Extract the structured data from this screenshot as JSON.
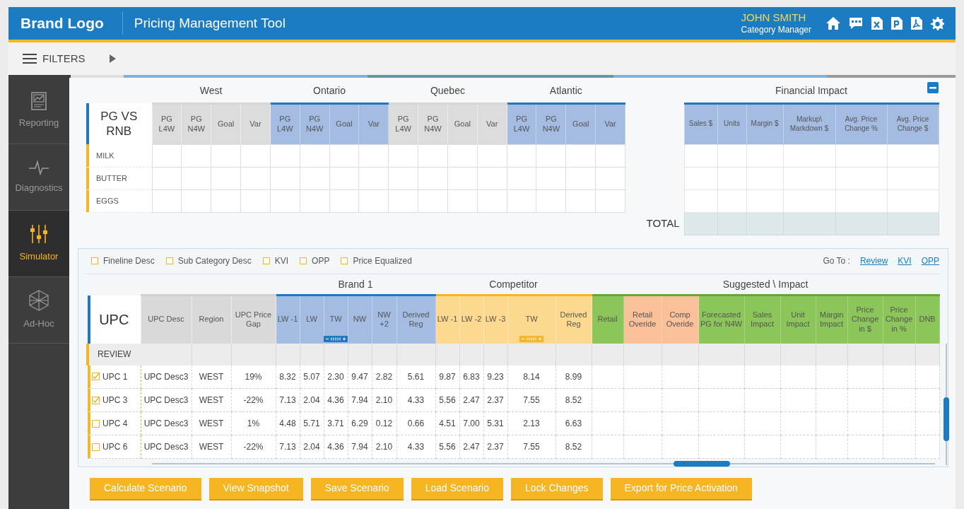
{
  "header": {
    "logo": "Brand Logo",
    "title": "Pricing Management Tool",
    "user_name": "JOHN SMITH",
    "user_role": "Category Manager"
  },
  "filter_bar": {
    "label": "FILTERS"
  },
  "sidebar": {
    "items": [
      {
        "label": "Reporting",
        "kind": "report",
        "selected": false
      },
      {
        "label": "Diagnostics",
        "kind": "pulse",
        "selected": false
      },
      {
        "label": "Simulator",
        "kind": "sliders",
        "selected": true
      },
      {
        "label": "Ad-Hoc",
        "kind": "cube",
        "selected": false
      }
    ]
  },
  "region_table": {
    "corner": "PG VS RNB",
    "groups": [
      {
        "label": "West",
        "highlighted": false,
        "columns": [
          "PG L4W",
          "PG N4W",
          "Goal",
          "Var"
        ]
      },
      {
        "label": "Ontario",
        "highlighted": true,
        "columns": [
          "PG L4W",
          "PG N4W",
          "Goal",
          "Var"
        ]
      },
      {
        "label": "Quebec",
        "highlighted": false,
        "columns": [
          "PG L4W",
          "PG N4W",
          "Goal",
          "Var"
        ]
      },
      {
        "label": "Atlantic",
        "highlighted": true,
        "columns": [
          "PG L4W",
          "PG N4W",
          "Goal",
          "Var"
        ]
      }
    ],
    "rows": [
      "MILK",
      "BUTTER",
      "EGGS"
    ]
  },
  "financial_impact": {
    "title": "Financial Impact",
    "columns": [
      "Sales $",
      "Units",
      "Margin $",
      "Markup\\ Markdown $",
      "Avg. Price Change %",
      "Avg. Price Change $"
    ],
    "total_label": "TOTAL"
  },
  "legend": [
    {
      "label": "Fineline Desc",
      "checked": false
    },
    {
      "label": "Sub Category Desc",
      "checked": false
    },
    {
      "label": "KVI",
      "checked": false
    },
    {
      "label": "OPP",
      "checked": false
    },
    {
      "label": "Price Equalized",
      "checked": false
    }
  ],
  "goto": {
    "label": "Go To :",
    "links": [
      "Review",
      "KVI",
      "OPP"
    ]
  },
  "upc_table": {
    "key_column": "UPC",
    "groups": [
      {
        "kind": "plain",
        "columns": [
          {
            "label": "UPC Desc",
            "kind": "plain",
            "stepper": false
          },
          {
            "label": "Region",
            "kind": "plain",
            "stepper": false
          },
          {
            "label": "UPC Price Gap",
            "kind": "plain",
            "stepper": false
          }
        ]
      },
      {
        "label": "Brand 1",
        "kind": "brand",
        "columns": [
          {
            "label": "LW -1",
            "kind": "brand",
            "stepper": false
          },
          {
            "label": "LW",
            "kind": "brand",
            "stepper": false
          },
          {
            "label": "TW",
            "kind": "brand",
            "stepper": true
          },
          {
            "label": "NW",
            "kind": "brand",
            "stepper": false
          },
          {
            "label": "NW +2",
            "kind": "brand",
            "stepper": false
          },
          {
            "label": "Derived Reg",
            "kind": "brand",
            "stepper": false
          }
        ]
      },
      {
        "label": "Competitor",
        "kind": "competitor",
        "columns": [
          {
            "label": "LW -1",
            "kind": "competitor",
            "stepper": false
          },
          {
            "label": "LW -2",
            "kind": "competitor",
            "stepper": false
          },
          {
            "label": "LW -3",
            "kind": "competitor",
            "stepper": false
          },
          {
            "label": "TW",
            "kind": "competitor",
            "stepper": true
          },
          {
            "label": "Derived Reg",
            "kind": "competitor",
            "stepper": false
          }
        ]
      },
      {
        "label": "Suggested \\ Impact",
        "kind": "suggested",
        "columns": [
          {
            "label": "Retail",
            "kind": "suggested",
            "stepper": false
          },
          {
            "label": "Retail Overide",
            "kind": "override",
            "stepper": false
          },
          {
            "label": "Comp Overide",
            "kind": "override",
            "stepper": false
          },
          {
            "label": "Forecasted PG for N4W",
            "kind": "suggested",
            "stepper": false
          },
          {
            "label": "Sales Impact",
            "kind": "suggested",
            "stepper": false
          },
          {
            "label": "Unit Impact",
            "kind": "suggested",
            "stepper": false
          },
          {
            "label": "Margin Impact",
            "kind": "suggested",
            "stepper": false
          },
          {
            "label": "Price Change in $",
            "kind": "suggested",
            "stepper": false
          },
          {
            "label": "Price Change in %",
            "kind": "suggested",
            "stepper": false
          },
          {
            "label": "DNB",
            "kind": "suggested",
            "stepper": false
          }
        ]
      }
    ],
    "section_label": "REVIEW",
    "rows": [
      {
        "upc": "UPC 1",
        "checked": true,
        "cells": [
          "UPC Desc3",
          "WEST",
          "19%",
          "8.32",
          "5.07",
          "2.30",
          "9.47",
          "2.82",
          "5.61",
          "9.87",
          "6.83",
          "9.23",
          "8.14",
          "8.99"
        ]
      },
      {
        "upc": "UPC 3",
        "checked": true,
        "cells": [
          "UPC Desc3",
          "WEST",
          "-22%",
          "7.13",
          "2.04",
          "4.36",
          "7.94",
          "2.10",
          "4.33",
          "5.56",
          "2.47",
          "2.37",
          "7.55",
          "8.52"
        ]
      },
      {
        "upc": "UPC 4",
        "checked": false,
        "cells": [
          "UPC Desc3",
          "WEST",
          "1%",
          "4.48",
          "5.71",
          "3.71",
          "6.29",
          "0.12",
          "0.66",
          "4.51",
          "7.00",
          "5.31",
          "2.13",
          "6.63"
        ]
      },
      {
        "upc": "UPC 6",
        "checked": false,
        "cells": [
          "UPC Desc3",
          "WEST",
          "-22%",
          "7.13",
          "2.04",
          "4.36",
          "7.94",
          "2.10",
          "4.33",
          "5.56",
          "2.47",
          "2.37",
          "7.55",
          "8.52"
        ]
      }
    ]
  },
  "buttons": [
    "Calculate Scenario",
    "View Snapshot",
    "Save Scenario",
    "Load Scenario",
    "Lock Changes",
    "Export for Price Activation"
  ]
}
